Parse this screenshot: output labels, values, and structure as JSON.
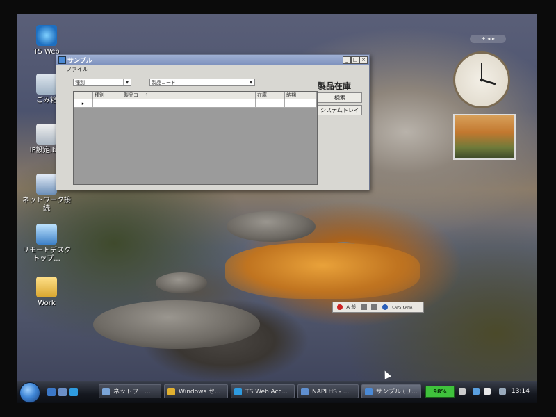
{
  "desktop": {
    "icons": [
      {
        "label": "TS Web"
      },
      {
        "label": "ごみ箱"
      },
      {
        "label": "IP設定.bat"
      },
      {
        "label": "ネットワーク接続"
      },
      {
        "label": "リモートデスクトップ..."
      },
      {
        "label": "Work"
      }
    ]
  },
  "window": {
    "title": "サンプル",
    "menu": {
      "file": "ファイル"
    },
    "filters": {
      "category": "種別",
      "product": "製品コード"
    },
    "heading": "製品在庫",
    "buttons": {
      "search": "検索",
      "system_tray": "システムトレイ"
    },
    "grid": {
      "columns": [
        "種別",
        "製品コード",
        "在庫",
        "納期"
      ],
      "row_marker": "▸"
    },
    "controls": {
      "minimize": "_",
      "maximize": "□",
      "close": "×"
    }
  },
  "language_bar": {
    "text": "A 般",
    "mode1": "CAPS",
    "mode2": "KANA"
  },
  "sidebar": {
    "control": "+ ◂ ▸"
  },
  "taskbar": {
    "items": [
      {
        "label": "ネットワー..."
      },
      {
        "label": "Windows セ..."
      },
      {
        "label": "TS Web Acc..."
      },
      {
        "label": "NAPLHS - ..."
      },
      {
        "label": "サンプル (リ..."
      }
    ],
    "battery": "98%",
    "time": "13:14"
  }
}
